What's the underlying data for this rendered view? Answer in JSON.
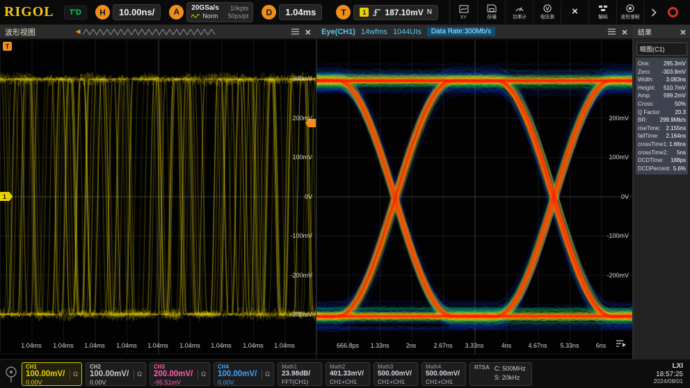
{
  "header": {
    "logo": "RIGOL",
    "trig_status": "T'D",
    "knob_h": "H",
    "timebase": "10.00ns/",
    "knob_a": "A",
    "sample_rate": "20GSa/s",
    "mem_depth": "10kpts",
    "acq_mode": "Norm",
    "sample_res": "50ps/pt",
    "knob_d": "D",
    "hoffset": "1.04ms",
    "knob_t": "T",
    "trig_source": "1",
    "trig_level": "187.10mV",
    "trig_mode": "N",
    "toolbar": [
      {
        "label": "XY"
      },
      {
        "label": "存储"
      },
      {
        "label": "功率计"
      },
      {
        "label": "电压表"
      },
      {
        "label": ""
      },
      {
        "label": "解码"
      },
      {
        "label": "波形录制"
      }
    ]
  },
  "waveform_panel": {
    "title": "波形视图",
    "trigger_marker": "T",
    "channel_marker": "1",
    "y_labels": [
      "300mV",
      "200mV",
      "100mV",
      "0V",
      "-100mV",
      "-200mV",
      "-300mV"
    ],
    "x_labels": [
      "1.04ms",
      "1.04ms",
      "1.04ms",
      "1.04ms",
      "1.04ms",
      "1.04ms",
      "1.04ms",
      "1.04ms",
      "1.04ms"
    ]
  },
  "eye_panel": {
    "title": "Eye(CH1)",
    "wfms": "14wfms",
    "uis": "1044UIs",
    "data_rate": "Data Rate:300Mb/s",
    "y_labels": [
      "200mV",
      "100mV",
      "0V",
      "-100mV",
      "-200mV"
    ],
    "x_labels": [
      "666.8ps",
      "1.33ns",
      "2ns",
      "2.67ns",
      "3.33ns",
      "4ns",
      "4.67ns",
      "5.33ns",
      "6ns"
    ]
  },
  "results_panel": {
    "title": "结果",
    "group_title": "眼图(C1)",
    "measurements": [
      {
        "k": "One:",
        "v": "295.3mV"
      },
      {
        "k": "Zero:",
        "v": "-303.9mV"
      },
      {
        "k": "Width:",
        "v": "3.083ns"
      },
      {
        "k": "Height:",
        "v": "510.7mV"
      },
      {
        "k": "Amp:",
        "v": "599.2mV"
      },
      {
        "k": "Cross:",
        "v": "50%"
      },
      {
        "k": "Q Factor:",
        "v": "20.3"
      },
      {
        "k": "BR:",
        "v": "299.9Mb/s"
      },
      {
        "k": "riseTime:",
        "v": "2.155ns"
      },
      {
        "k": "fallTime:",
        "v": "2.164ns"
      },
      {
        "k": "crossTime1:",
        "v": "1.66ns"
      },
      {
        "k": "crossTime2:",
        "v": "5ns"
      },
      {
        "k": "DCDTime:",
        "v": "188ps"
      },
      {
        "k": "DCDPercent:",
        "v": "5.6%"
      }
    ]
  },
  "bottom_bar": {
    "channels": [
      {
        "name": "CH1",
        "value": "100.00mV/",
        "unit": "Ω",
        "line2": "0.00V",
        "color": "#e6d200",
        "active": true
      },
      {
        "name": "CH2",
        "value": "100.00mV/",
        "unit": "Ω",
        "line2": "0.00V",
        "color": "#c8c8c8",
        "active": false
      },
      {
        "name": "CH3",
        "value": "200.00mV/",
        "unit": "Ω",
        "line2": "-95.51mV",
        "color": "#ff5fae",
        "active": false
      },
      {
        "name": "CH4",
        "value": "100.00mV/",
        "unit": "Ω",
        "line2": "0.00V",
        "color": "#3da5ff",
        "active": false
      }
    ],
    "maths": [
      {
        "name": "Math1",
        "value": "23.98dB/",
        "line2": "FFT(CH1)"
      },
      {
        "name": "Math2",
        "value": "401.33mV/",
        "line2": "CH1+CH1"
      },
      {
        "name": "Math3",
        "value": "500.00mV/",
        "line2": "CH1+CH1"
      },
      {
        "name": "Math4",
        "value": "500.00mV/",
        "line2": "CH1+CH1"
      }
    ],
    "rtsa": {
      "name": "RTSA",
      "line1": "C: 500MHz",
      "line2": "S: 20kHz"
    },
    "lxi": "LXI",
    "time": "18:57:25",
    "date": "2024/08/01"
  },
  "colors": {
    "accent_orange": "#ef8e1a",
    "trig_green": "#00d455",
    "ch1_yellow": "#e6d200",
    "ch3_pink": "#ff5fae",
    "ch4_blue": "#3da5ff",
    "eye_header_cyan": "#59c8f0"
  }
}
